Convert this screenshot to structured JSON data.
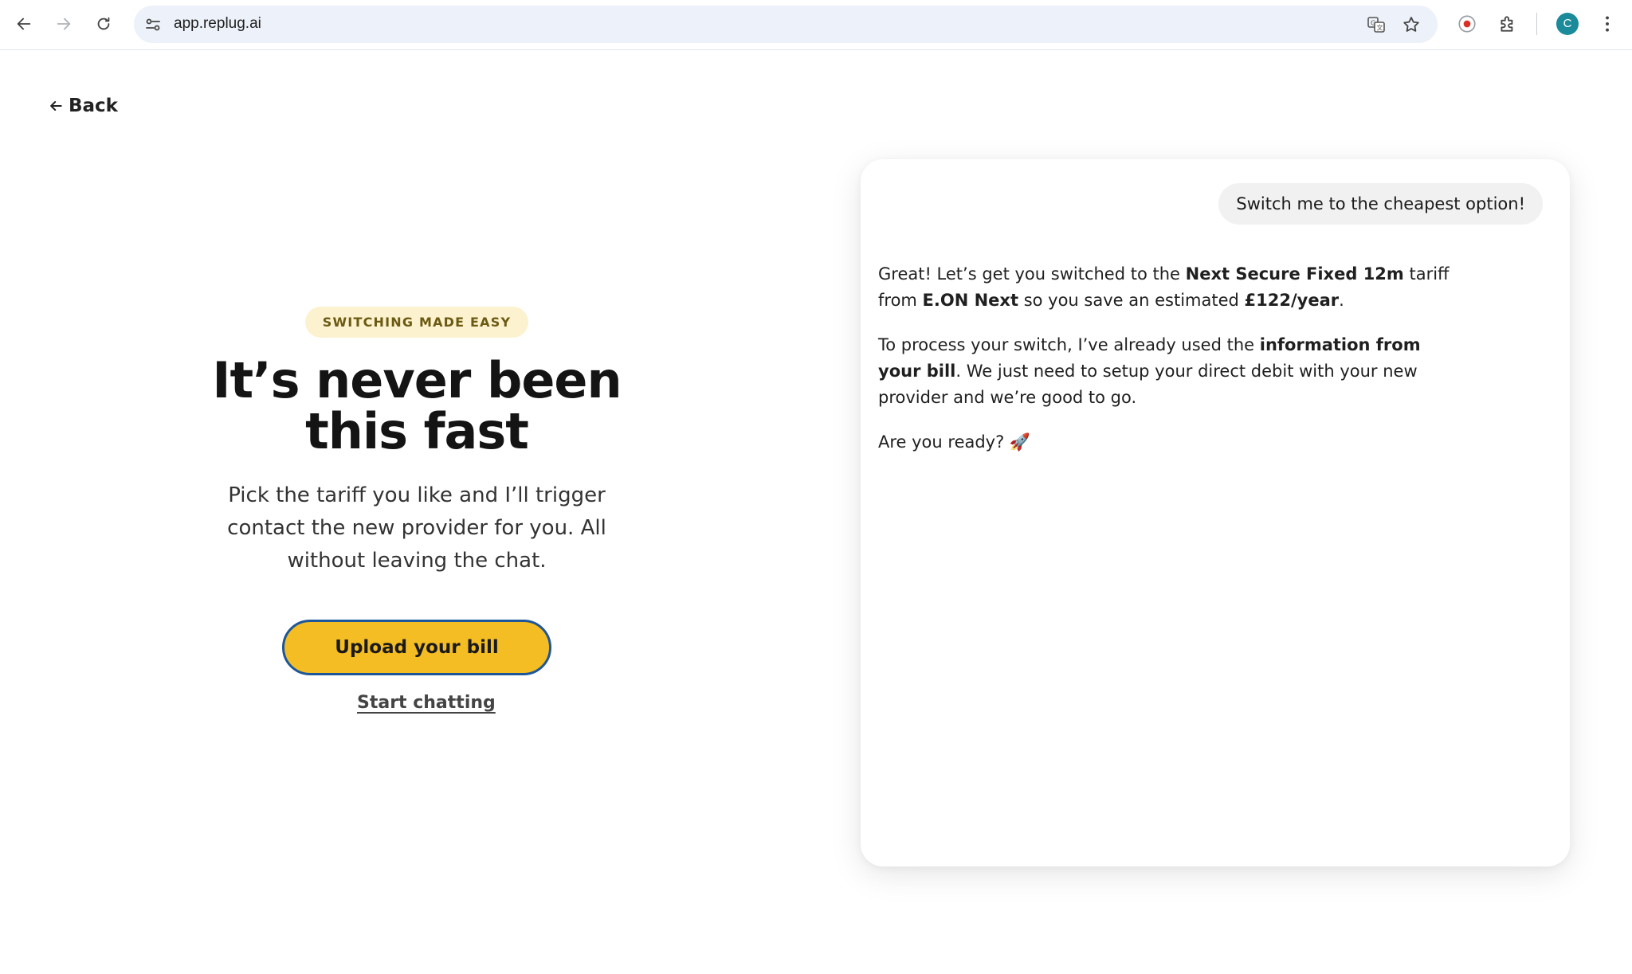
{
  "browser": {
    "url": "app.replug.ai",
    "avatar_letter": "C",
    "icons": [
      "back-arrow-icon",
      "forward-arrow-icon",
      "reload-icon",
      "site-settings-icon",
      "translate-icon",
      "bookmark-star-icon",
      "record-icon",
      "extensions-icon",
      "more-menu-icon"
    ]
  },
  "page": {
    "back_label": "Back",
    "badge": "SWITCHING MADE EASY",
    "headline_line1": "It’s never been",
    "headline_line2": "this fast",
    "subtext": "Pick the tariff you like and I’ll trigger contact the new provider for you. All without leaving the chat.",
    "upload_label": "Upload your bill",
    "chat_label": "Start chatting"
  },
  "chat": {
    "user_message": "Switch me to the cheapest option!",
    "bot": {
      "p1_a": "Great! Let’s get you switched to the ",
      "p1_tariff": "Next Secure Fixed 12m",
      "p1_b": " tariff from ",
      "p1_provider": "E.ON Next",
      "p1_c": " so you save an estimated ",
      "p1_saving": "£122/year",
      "p1_d": ".",
      "p2_a": "To process your switch, I’ve already used the ",
      "p2_bold": "information from your bill",
      "p2_b": ". We just need to setup your direct debit with your new provider and we’re good to go.",
      "p3": "Are you ready? 🚀"
    }
  },
  "colors": {
    "accent_yellow": "#f4bd23",
    "button_border": "#1d5699",
    "badge_bg": "#fdf2cf",
    "avatar_bg": "#1b8a9a"
  }
}
